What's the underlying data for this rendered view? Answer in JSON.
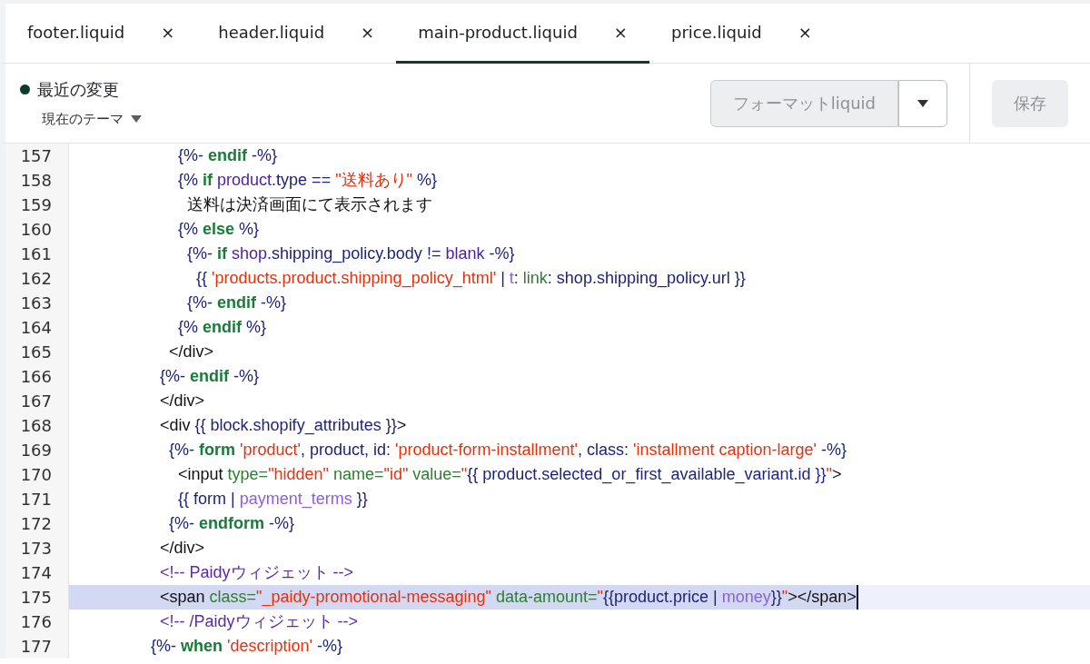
{
  "tabs": [
    {
      "label": "footer.liquid",
      "close": "×",
      "selected": false
    },
    {
      "label": "header.liquid",
      "close": "×",
      "selected": false
    },
    {
      "label": "main-product.liquid",
      "close": "×",
      "selected": true
    },
    {
      "label": "price.liquid",
      "close": "×",
      "selected": false
    }
  ],
  "toolbar": {
    "status": {
      "label": "最近の変更",
      "color": "#0d3b2e"
    },
    "theme_dropdown": "現在のテーマ",
    "format_button": {
      "label": "フォーマットliquid",
      "disabled": true
    },
    "save_button": {
      "label": "保存",
      "disabled": true
    }
  },
  "code_lines": [
    {
      "number": "157",
      "selected": false,
      "tokens": [
        {
          "kind": "delim",
          "text": "                      {%-"
        },
        {
          "kind": "keyword",
          "text": " endif"
        },
        {
          "kind": "delim",
          "text": " -%}"
        }
      ]
    },
    {
      "number": "158",
      "selected": false,
      "tokens": [
        {
          "kind": "delim",
          "text": "                      {%"
        },
        {
          "kind": "keyword",
          "text": " if"
        },
        {
          "kind": "var",
          "text": " product"
        },
        {
          "kind": "delim",
          "text": ".type == "
        },
        {
          "kind": "string",
          "text": "\"送料あり\""
        },
        {
          "kind": "delim",
          "text": " %}"
        }
      ]
    },
    {
      "number": "159",
      "selected": false,
      "tokens": [
        {
          "kind": "plain",
          "text": "                        送料は決済画面にて表示されます"
        }
      ]
    },
    {
      "number": "160",
      "selected": false,
      "tokens": [
        {
          "kind": "delim",
          "text": "                      {%"
        },
        {
          "kind": "keyword",
          "text": " else"
        },
        {
          "kind": "delim",
          "text": " %}"
        }
      ]
    },
    {
      "number": "161",
      "selected": false,
      "tokens": [
        {
          "kind": "delim",
          "text": "                        {%-"
        },
        {
          "kind": "keyword",
          "text": " if"
        },
        {
          "kind": "var",
          "text": " shop"
        },
        {
          "kind": "delim",
          "text": ".shipping_policy.body != "
        },
        {
          "kind": "var",
          "text": "blank"
        },
        {
          "kind": "delim",
          "text": " -%}"
        }
      ]
    },
    {
      "number": "162",
      "selected": false,
      "tokens": [
        {
          "kind": "delim",
          "text": "                          {{ "
        },
        {
          "kind": "string",
          "text": "'products.product.shipping_policy_html'"
        },
        {
          "kind": "delim",
          "text": " | "
        },
        {
          "kind": "filter",
          "text": "t"
        },
        {
          "kind": "delim",
          "text": ": "
        },
        {
          "kind": "attr",
          "text": "link"
        },
        {
          "kind": "delim",
          "text": ": shop.shipping_policy.url }}"
        }
      ]
    },
    {
      "number": "163",
      "selected": false,
      "tokens": [
        {
          "kind": "delim",
          "text": "                        {%-"
        },
        {
          "kind": "keyword",
          "text": " endif"
        },
        {
          "kind": "delim",
          "text": " -%}"
        }
      ]
    },
    {
      "number": "164",
      "selected": false,
      "tokens": [
        {
          "kind": "delim",
          "text": "                      {%"
        },
        {
          "kind": "keyword",
          "text": " endif"
        },
        {
          "kind": "delim",
          "text": " %}"
        }
      ]
    },
    {
      "number": "165",
      "selected": false,
      "tokens": [
        {
          "kind": "plain",
          "text": "                    </div>"
        }
      ]
    },
    {
      "number": "166",
      "selected": false,
      "tokens": [
        {
          "kind": "delim",
          "text": "                  {%-"
        },
        {
          "kind": "keyword",
          "text": " endif"
        },
        {
          "kind": "delim",
          "text": " -%}"
        }
      ]
    },
    {
      "number": "167",
      "selected": false,
      "tokens": [
        {
          "kind": "plain",
          "text": "                  </div>"
        }
      ]
    },
    {
      "number": "168",
      "selected": false,
      "tokens": [
        {
          "kind": "plain",
          "text": "                  <div "
        },
        {
          "kind": "delim",
          "text": "{{ block.shopify_attributes }}"
        },
        {
          "kind": "plain",
          "text": ">"
        }
      ]
    },
    {
      "number": "169",
      "selected": false,
      "tokens": [
        {
          "kind": "delim",
          "text": "                    {%-"
        },
        {
          "kind": "keyword",
          "text": " form"
        },
        {
          "kind": "string",
          "text": " 'product'"
        },
        {
          "kind": "delim",
          "text": ", product, id: "
        },
        {
          "kind": "string",
          "text": "'product-form-installment'"
        },
        {
          "kind": "delim",
          "text": ", class: "
        },
        {
          "kind": "string",
          "text": "'installment caption-large'"
        },
        {
          "kind": "delim",
          "text": " -%}"
        }
      ]
    },
    {
      "number": "170",
      "selected": false,
      "tokens": [
        {
          "kind": "plain",
          "text": "                      <input "
        },
        {
          "kind": "attr",
          "text": "type="
        },
        {
          "kind": "string",
          "text": "\"hidden\""
        },
        {
          "kind": "attr",
          "text": " name="
        },
        {
          "kind": "string",
          "text": "\"id\""
        },
        {
          "kind": "attr",
          "text": " value="
        },
        {
          "kind": "string",
          "text": "\""
        },
        {
          "kind": "delim",
          "text": "{{ product.selected_or_first_available_variant.id }}"
        },
        {
          "kind": "string",
          "text": "\""
        },
        {
          "kind": "plain",
          "text": ">"
        }
      ]
    },
    {
      "number": "171",
      "selected": false,
      "tokens": [
        {
          "kind": "delim",
          "text": "                      {{ form | "
        },
        {
          "kind": "filter",
          "text": "payment_terms"
        },
        {
          "kind": "delim",
          "text": " }}"
        }
      ]
    },
    {
      "number": "172",
      "selected": false,
      "tokens": [
        {
          "kind": "delim",
          "text": "                    {%-"
        },
        {
          "kind": "keyword",
          "text": " endform"
        },
        {
          "kind": "delim",
          "text": " -%}"
        }
      ]
    },
    {
      "number": "173",
      "selected": false,
      "tokens": [
        {
          "kind": "plain",
          "text": "                  </div>"
        }
      ]
    },
    {
      "number": "174",
      "selected": false,
      "tokens": [
        {
          "kind": "comment",
          "text": "                  <!-- Paidyウィジェット -->"
        }
      ]
    },
    {
      "number": "175",
      "selected": true,
      "tokens": [
        {
          "kind": "plain",
          "text": "                  <span "
        },
        {
          "kind": "attr",
          "text": "class="
        },
        {
          "kind": "string",
          "text": "\"_paidy-promotional-messaging\""
        },
        {
          "kind": "attr",
          "text": " data-amount="
        },
        {
          "kind": "string",
          "text": "\""
        },
        {
          "kind": "delim",
          "text": "{{product.price | "
        },
        {
          "kind": "filter",
          "text": "money"
        },
        {
          "kind": "delim",
          "text": "}}"
        },
        {
          "kind": "string",
          "text": "\""
        },
        {
          "kind": "plain",
          "text": "></span>"
        }
      ]
    },
    {
      "number": "176",
      "selected": false,
      "tokens": [
        {
          "kind": "comment",
          "text": "                  <!-- /Paidyウィジェット -->"
        }
      ]
    },
    {
      "number": "177",
      "selected": false,
      "tokens": [
        {
          "kind": "delim",
          "text": "                {%-"
        },
        {
          "kind": "keyword",
          "text": " when"
        },
        {
          "kind": "string",
          "text": " 'description'"
        },
        {
          "kind": "delim",
          "text": " -%}"
        }
      ]
    }
  ]
}
